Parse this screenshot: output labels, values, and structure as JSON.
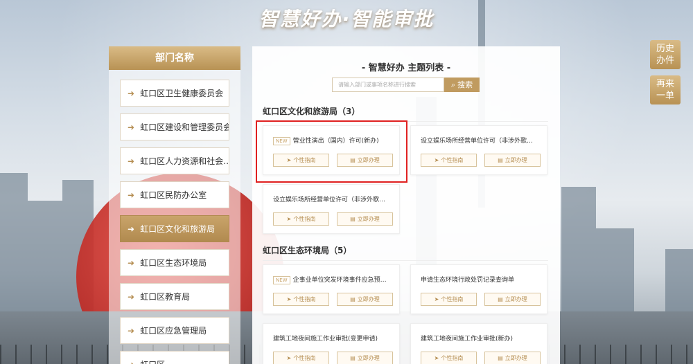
{
  "page_title": "智慧好办·智能审批",
  "departments": {
    "header": "部门名称",
    "items": [
      {
        "label": "虹口区卫生健康委员会",
        "active": false
      },
      {
        "label": "虹口区建设和管理委员会",
        "active": false
      },
      {
        "label": "虹口区人力资源和社会…",
        "active": false
      },
      {
        "label": "虹口区民防办公室",
        "active": false
      },
      {
        "label": "虹口区文化和旅游局",
        "active": true
      },
      {
        "label": "虹口区生态环境局",
        "active": false
      },
      {
        "label": "虹口区教育局",
        "active": false
      },
      {
        "label": "虹口区应急管理局",
        "active": false
      },
      {
        "label": "虹口区…",
        "active": false
      }
    ]
  },
  "main": {
    "title": "- 智慧好办 主题列表 -",
    "search": {
      "placeholder": "请输入部门或事项名称进行搜索",
      "button_label": "搜索"
    },
    "sections": [
      {
        "heading": "虹口区文化和旅游局（3）",
        "cards": [
          {
            "name": "营业性演出（国内）许可(新办)",
            "is_new": true,
            "new_label": "NEW",
            "guide_label": "个性指南",
            "apply_label": "立即办理"
          },
          {
            "name": "设立娱乐场所经营单位许可（非涉外歌舞…",
            "is_new": false,
            "guide_label": "个性指南",
            "apply_label": "立即办理"
          },
          {
            "name": "设立娱乐场所经营单位许可（非涉外歌舞…",
            "is_new": false,
            "guide_label": "个性指南",
            "apply_label": "立即办理"
          }
        ]
      },
      {
        "heading": "虹口区生态环境局（5）",
        "cards": [
          {
            "name": "企事业单位突发环境事件应急预案…",
            "is_new": true,
            "new_label": "NEW",
            "guide_label": "个性指南",
            "apply_label": "立即办理"
          },
          {
            "name": "申请生态环境行政处罚记录查询单",
            "is_new": false,
            "guide_label": "个性指南",
            "apply_label": "立即办理"
          },
          {
            "name": "建筑工地夜间施工作业审批(变更申请)",
            "is_new": false,
            "guide_label": "个性指南",
            "apply_label": "立即办理"
          },
          {
            "name": "建筑工地夜间施工作业审批(新办)",
            "is_new": false,
            "guide_label": "个性指南",
            "apply_label": "立即办理"
          }
        ]
      }
    ]
  },
  "side_buttons": [
    {
      "line1": "历史",
      "line2": "办件"
    },
    {
      "line1": "再来",
      "line2": "一单"
    }
  ]
}
